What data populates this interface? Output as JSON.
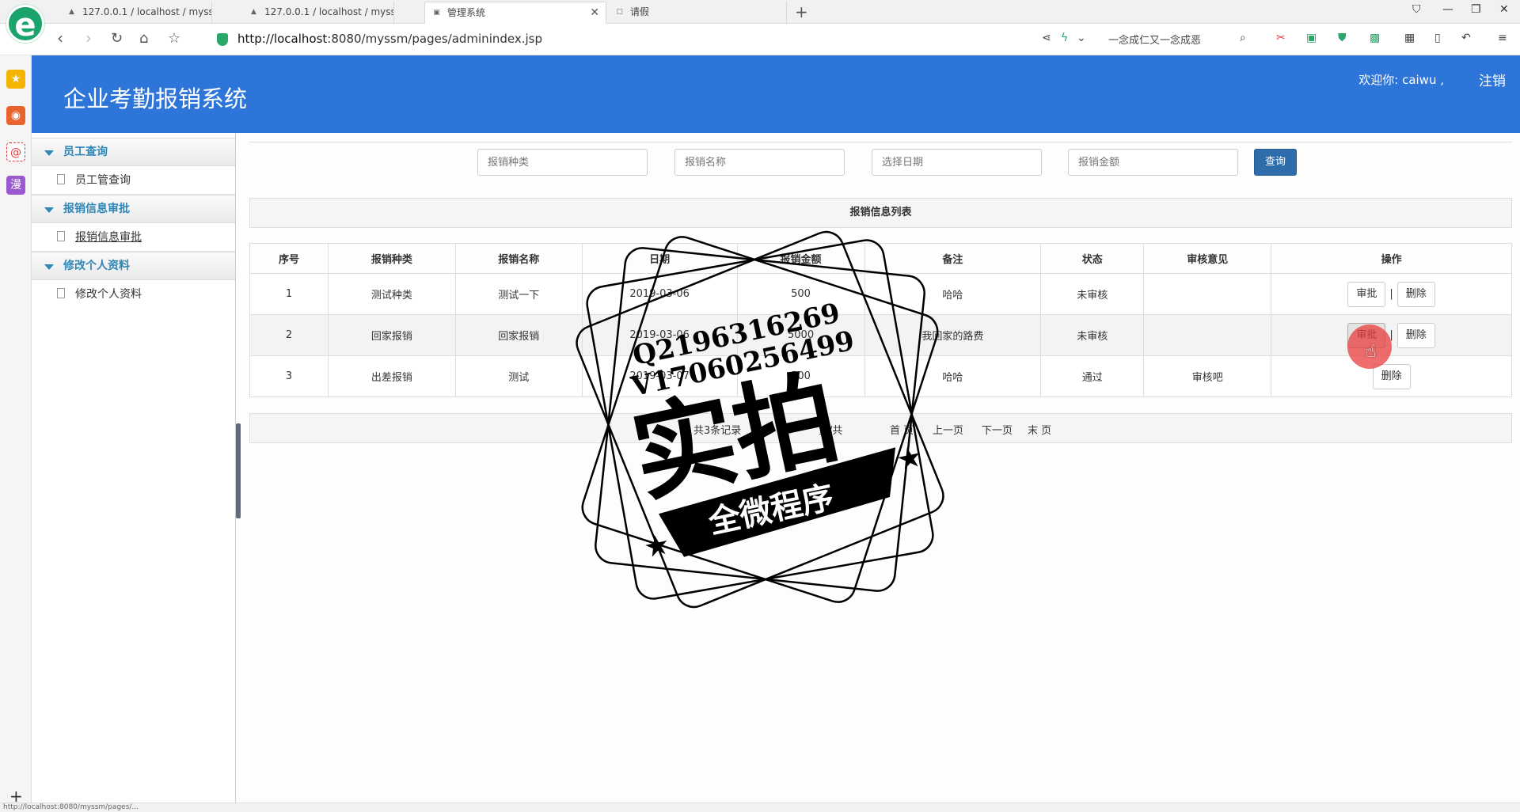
{
  "browser": {
    "tabs": [
      {
        "label": "127.0.0.1 / localhost / myssm"
      },
      {
        "label": "127.0.0.1 / localhost / myssm"
      },
      {
        "label": "管理系统"
      },
      {
        "label": "请假"
      }
    ],
    "url_host": "http://localhost",
    "url_rest": ":8080/myssm/pages/adminindex.jsp",
    "search_text": "一念成仁又一念成恶"
  },
  "app": {
    "title": "企业考勤报销系统",
    "welcome": "欢迎你: caiwu ,",
    "logout": "注销"
  },
  "sidebar": {
    "groups": [
      {
        "label": "员工查询",
        "item": "员工管查询"
      },
      {
        "label": "报销信息审批",
        "item": "报销信息审批"
      },
      {
        "label": "修改个人资料",
        "item": "修改个人资料"
      }
    ]
  },
  "search": {
    "type_placeholder": "报销种类",
    "name_placeholder": "报销名称",
    "date_placeholder": "选择日期",
    "amount_placeholder": "报销金额",
    "button": "查询"
  },
  "list": {
    "title": "报销信息列表",
    "headers": [
      "序号",
      "报销种类",
      "报销名称",
      "日期",
      "报销金额",
      "备注",
      "状态",
      "审核意见",
      "操作"
    ],
    "rows": [
      {
        "no": "1",
        "type": "测试种类",
        "name": "测试一下",
        "date": "2019-03-06",
        "amount": "500",
        "remark": "哈哈",
        "status": "未审核",
        "opinion": ""
      },
      {
        "no": "2",
        "type": "回家报销",
        "name": "回家报销",
        "date": "2019-03-06",
        "amount": "5000",
        "remark": "我回家的路费",
        "status": "未审核",
        "opinion": ""
      },
      {
        "no": "3",
        "type": "出差报销",
        "name": "测试",
        "date": "2019-03-07",
        "amount": "500",
        "remark": "哈哈",
        "status": "通过",
        "opinion": "审核吧"
      }
    ],
    "approve_label": "审批",
    "delete_label": "删除",
    "separator": "|"
  },
  "pager": {
    "total": "共3条记录",
    "per_page": "每",
    "pages": "页/共",
    "first": "首 页",
    "prev": "上一页",
    "next": "下一页",
    "last": "末 页"
  },
  "watermark": {
    "line1": "Q2196316269",
    "line2": "V17060256499",
    "big": "实拍",
    "banner": "全微程序"
  },
  "statusbar": {
    "text": "http://localhost:8080/myssm/pages/..."
  }
}
